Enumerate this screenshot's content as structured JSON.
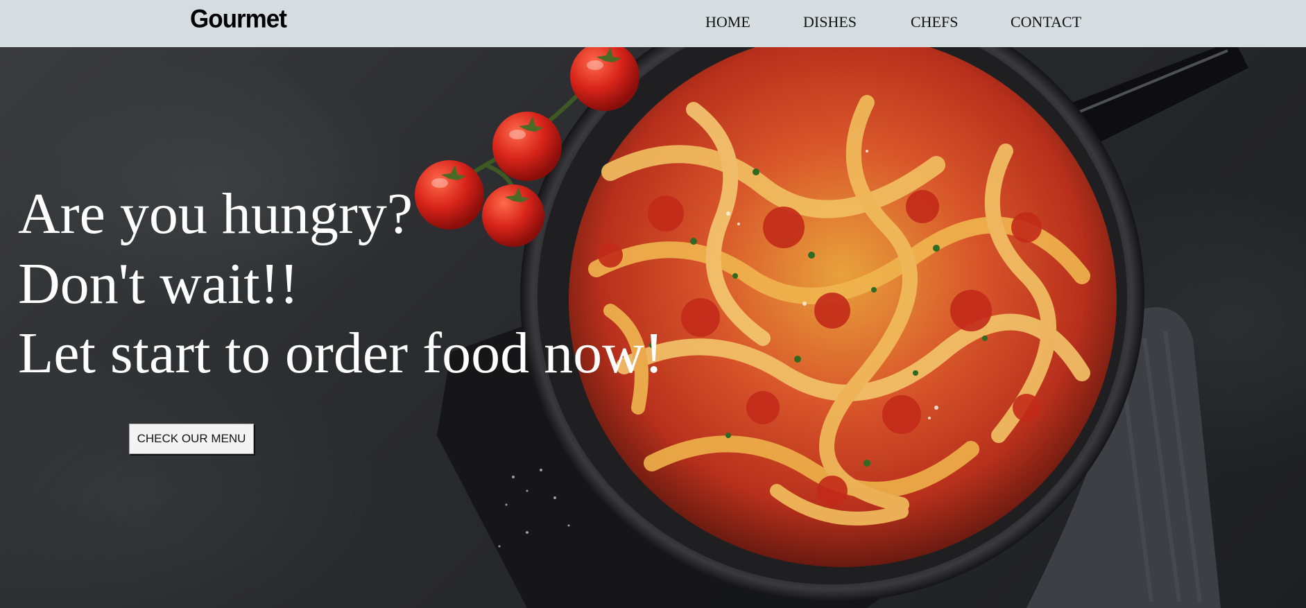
{
  "brand": {
    "name": "Gourmet"
  },
  "nav": {
    "home": "HOME",
    "dishes": "DISHES",
    "chefs": "CHEFS",
    "contact": "CONTACT"
  },
  "hero": {
    "line1": "Are you hungry?",
    "line2": "Don't wait!!",
    "line3": "Let start to order food now!",
    "cta_label": "CHECK OUR MENU",
    "image_alt": "pappardelle-pasta-in-pan"
  },
  "colors": {
    "navbar_bg": "#d6dde1",
    "hero_bg": "#2b2c2f",
    "headline_text": "#ffffff",
    "button_bg": "#f3f3f3"
  }
}
